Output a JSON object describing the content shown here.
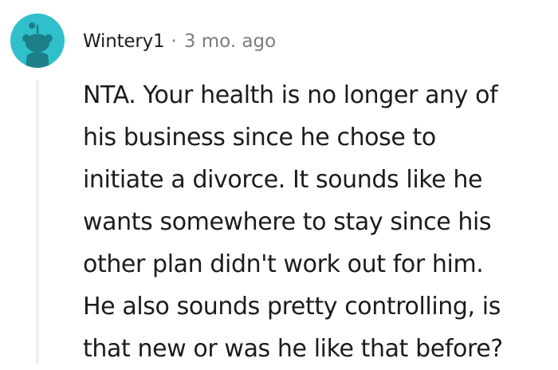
{
  "comment": {
    "author": "Wintery1",
    "separator": "·",
    "age": "3 mo. ago",
    "body_lines": [
      "NTA. Your health is no longer any of",
      "his business since he chose to",
      "initiate a divorce. It sounds like he",
      "wants somewhere to stay since his",
      "other plan didn't work out for him.",
      "He also sounds pretty controlling, is",
      "that new or was he like that before?"
    ]
  },
  "colors": {
    "avatar_bg": "#2fc0cb",
    "text": "#1c1c1c",
    "muted": "#7c7c7c",
    "thread_line": "#edeff1"
  },
  "icons": {
    "avatar": "reddit-snoo-avatar-icon"
  }
}
